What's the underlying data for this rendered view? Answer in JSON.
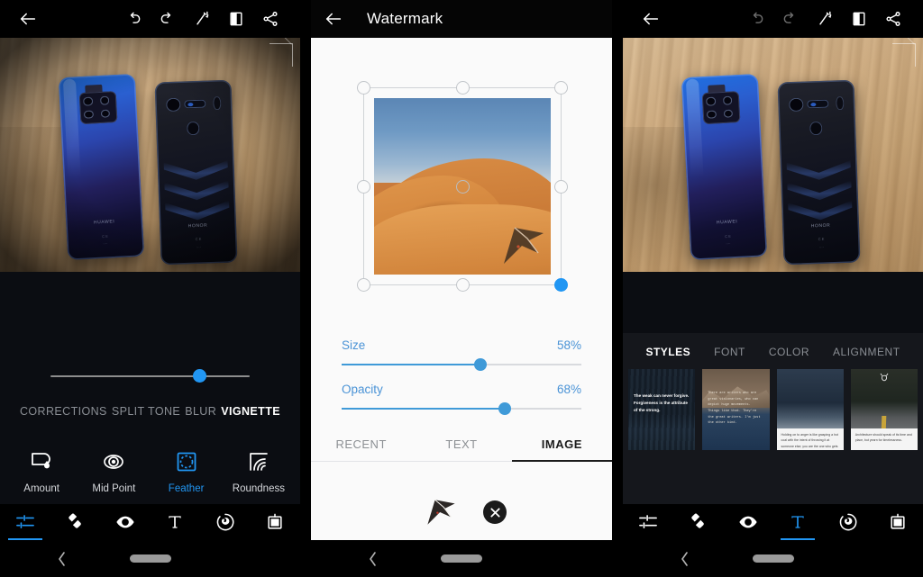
{
  "app": {
    "accent_blue": "#2196f3",
    "watermark_blue": "#4a93d6",
    "dark_bg": "#0b0d12",
    "light_bg": "#fafafa"
  },
  "panel1": {
    "toolbar": {
      "back": "back-arrow",
      "undo": "undo",
      "redo": "redo",
      "magic": "magic-wand",
      "compare": "compare",
      "share": "share"
    },
    "slider": {
      "value_percent": 75
    },
    "tabs": [
      {
        "label": "CORRECTIONS",
        "active": false
      },
      {
        "label": "SPLIT TONE",
        "active": false
      },
      {
        "label": "BLUR",
        "active": false
      },
      {
        "label": "VIGNETTE",
        "active": true
      }
    ],
    "tools": [
      {
        "label": "Amount",
        "icon": "amount-icon",
        "active": false
      },
      {
        "label": "Mid Point",
        "icon": "midpoint-icon",
        "active": false
      },
      {
        "label": "Feather",
        "icon": "feather-icon",
        "active": true
      },
      {
        "label": "Roundness",
        "icon": "roundness-icon",
        "active": false
      }
    ],
    "bottom_nav": [
      {
        "icon": "adjust-sliders-icon",
        "active": true
      },
      {
        "icon": "heal-patch-icon",
        "active": false
      },
      {
        "icon": "eye-icon",
        "active": false
      },
      {
        "icon": "text-tool-icon",
        "active": false
      },
      {
        "icon": "retouch-icon",
        "active": false
      },
      {
        "icon": "frame-icon",
        "active": false
      }
    ]
  },
  "panel2": {
    "title": "Watermark",
    "back": "back-arrow",
    "sliders": [
      {
        "label": "Size",
        "value": "58%",
        "percent": 58
      },
      {
        "label": "Opacity",
        "value": "68%",
        "percent": 68
      }
    ],
    "tabs": [
      {
        "label": "RECENT",
        "active": false
      },
      {
        "label": "TEXT",
        "active": false
      },
      {
        "label": "IMAGE",
        "active": true
      }
    ],
    "content": {
      "logo_thumb": "watermark-logo-icon",
      "remove": "remove-watermark-icon"
    },
    "handles": {
      "active_handle": "bottom-right"
    }
  },
  "panel3": {
    "toolbar": {
      "back": "back-arrow",
      "undo": "undo",
      "redo": "redo",
      "magic": "magic-wand",
      "compare": "compare",
      "share": "share"
    },
    "tabs": [
      {
        "label": "STYLES",
        "active": true
      },
      {
        "label": "FONT",
        "active": false
      },
      {
        "label": "COLOR",
        "active": false
      },
      {
        "label": "ALIGNMENT",
        "active": false
      }
    ],
    "styles": [
      {
        "quote": "The weak can never forgive. Forgiveness is the attribute of the strong.",
        "caption": ""
      },
      {
        "quote": "There are writers who are great visionaries, who can depict huge movements. Things like that. They're the great writers. I'm just the other kind.",
        "caption": ""
      },
      {
        "quote": "",
        "caption": "Holding on to anger is like grasping a hot coal with the intent of throwing it at someone else; you are the one who gets burned."
      },
      {
        "quote": "",
        "caption": "Architecture should speak of its time and place, but yearn for timelessness."
      }
    ],
    "bottom_nav": [
      {
        "icon": "adjust-sliders-icon",
        "active": false
      },
      {
        "icon": "heal-patch-icon",
        "active": false
      },
      {
        "icon": "eye-icon",
        "active": false
      },
      {
        "icon": "text-tool-icon",
        "active": true
      },
      {
        "icon": "retouch-icon",
        "active": false
      },
      {
        "icon": "frame-icon",
        "active": false
      }
    ]
  }
}
